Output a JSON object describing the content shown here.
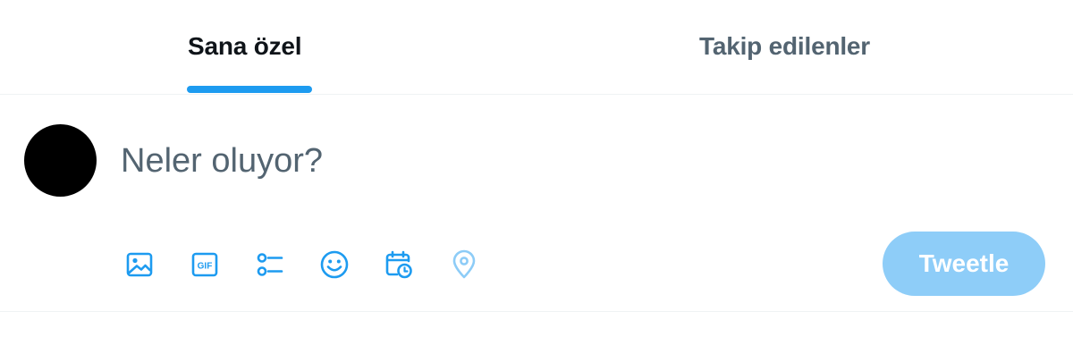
{
  "tabs": [
    {
      "label": "Sana özel",
      "selected": true
    },
    {
      "label": "Takip edilenler",
      "selected": false
    }
  ],
  "composer": {
    "placeholder": "Neler oluyor?",
    "value": ""
  },
  "toolbar": {
    "icons": [
      "media-icon",
      "gif-icon",
      "poll-icon",
      "emoji-icon",
      "schedule-icon",
      "location-icon"
    ],
    "gif_text": "GIF"
  },
  "tweet_button": {
    "label": "Tweetle",
    "enabled": false
  },
  "colors": {
    "accent": "#1d9bf0",
    "accent_disabled": "#8ecdf8",
    "text_primary": "#0f1419",
    "text_secondary": "#536471",
    "divider": "#eff3f4"
  }
}
